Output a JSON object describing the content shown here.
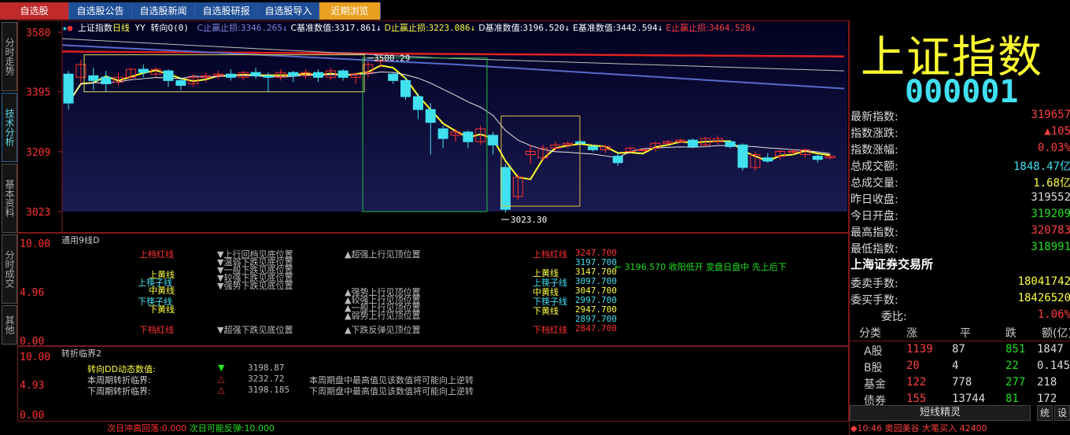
{
  "tabs": [
    "自选股",
    "自选股公告",
    "自选股新闻",
    "自选股研报",
    "自选股导入",
    "近期浏览"
  ],
  "side_tabs": [
    "分时走势",
    "技术分析",
    "基本资料",
    "分时成交",
    "其他"
  ],
  "chart_header": {
    "star": "★",
    "name": "上证指数",
    "period": "日线",
    "indicator": "YY 转向Q(0)",
    "items": [
      {
        "label": "C止赢止损:",
        "value": "3346.265↓",
        "color": "#7a8ae0"
      },
      {
        "label": "C基准数值:",
        "value": "3317.861↓",
        "color": "#ffffff"
      },
      {
        "label": "D止赢止损:",
        "value": "3223.086↓",
        "color": "#ffff40"
      },
      {
        "label": "D基准数值:",
        "value": "3196.520↓",
        "color": "#ffffff"
      },
      {
        "label": "E基准数值:",
        "value": "3442.594↓",
        "color": "#ffffff"
      },
      {
        "label": "E止赢止损:",
        "value": "3464.528↓",
        "color": "#ff4040"
      }
    ]
  },
  "price_axis": [
    "3580",
    "3395",
    "3209",
    "3023"
  ],
  "price_marks": {
    "high": "3500.29",
    "low": "3023.30"
  },
  "candles": [
    [
      3450,
      3360,
      3340,
      3460
    ],
    [
      3440,
      3480,
      3420,
      3495
    ],
    [
      3445,
      3430,
      3400,
      3470
    ],
    [
      3440,
      3420,
      3395,
      3460
    ],
    [
      3425,
      3440,
      3415,
      3455
    ],
    [
      3440,
      3465,
      3430,
      3470
    ],
    [
      3465,
      3455,
      3440,
      3480
    ],
    [
      3450,
      3465,
      3440,
      3470
    ],
    [
      3460,
      3430,
      3410,
      3465
    ],
    [
      3430,
      3415,
      3400,
      3440
    ],
    [
      3420,
      3440,
      3410,
      3450
    ],
    [
      3440,
      3445,
      3425,
      3455
    ],
    [
      3445,
      3450,
      3435,
      3460
    ],
    [
      3450,
      3440,
      3430,
      3465
    ],
    [
      3440,
      3455,
      3430,
      3460
    ],
    [
      3455,
      3445,
      3435,
      3470
    ],
    [
      3445,
      3440,
      3395,
      3455
    ],
    [
      3440,
      3455,
      3430,
      3465
    ],
    [
      3455,
      3445,
      3425,
      3460
    ],
    [
      3445,
      3455,
      3435,
      3465
    ],
    [
      3455,
      3440,
      3425,
      3465
    ],
    [
      3440,
      3460,
      3430,
      3470
    ],
    [
      3460,
      3440,
      3430,
      3465
    ],
    [
      3440,
      3450,
      3420,
      3455
    ],
    [
      3455,
      3480,
      3440,
      3490
    ],
    [
      3490,
      3500,
      3470,
      3500
    ],
    [
      3450,
      3430,
      3420,
      3455
    ],
    [
      3430,
      3380,
      3370,
      3440
    ],
    [
      3380,
      3340,
      3310,
      3390
    ],
    [
      3340,
      3300,
      3200,
      3360
    ],
    [
      3280,
      3250,
      3220,
      3290
    ],
    [
      3260,
      3270,
      3240,
      3280
    ],
    [
      3270,
      3240,
      3220,
      3275
    ],
    [
      3240,
      3280,
      3230,
      3290
    ],
    [
      3260,
      3230,
      3200,
      3270
    ],
    [
      3160,
      3030,
      3020,
      3170
    ],
    [
      3070,
      3130,
      3060,
      3140
    ],
    [
      3200,
      3210,
      3170,
      3230
    ],
    [
      3190,
      3220,
      3180,
      3230
    ],
    [
      3220,
      3230,
      3210,
      3240
    ],
    [
      3230,
      3235,
      3220,
      3240
    ],
    [
      3240,
      3235,
      3228,
      3245
    ],
    [
      3225,
      3215,
      3210,
      3230
    ],
    [
      3215,
      3225,
      3205,
      3230
    ],
    [
      3195,
      3175,
      3165,
      3205
    ],
    [
      3210,
      3220,
      3205,
      3225
    ],
    [
      3215,
      3215,
      3210,
      3220
    ],
    [
      3220,
      3235,
      3210,
      3240
    ],
    [
      3235,
      3240,
      3230,
      3245
    ],
    [
      3240,
      3245,
      3235,
      3250
    ],
    [
      3245,
      3225,
      3220,
      3250
    ],
    [
      3230,
      3250,
      3225,
      3255
    ],
    [
      3240,
      3250,
      3230,
      3260
    ],
    [
      3240,
      3225,
      3220,
      3245
    ],
    [
      3230,
      3160,
      3150,
      3235
    ],
    [
      3160,
      3200,
      3150,
      3210
    ],
    [
      3190,
      3180,
      3175,
      3205
    ],
    [
      3195,
      3210,
      3185,
      3215
    ],
    [
      3210,
      3210,
      3200,
      3218
    ],
    [
      3200,
      3215,
      3190,
      3220
    ],
    [
      3195,
      3185,
      3175,
      3200
    ],
    [
      3190,
      3195,
      3185,
      3200
    ]
  ],
  "pane2": {
    "title": "通用9线D",
    "axis": [
      "10.00",
      "4.96",
      "0.00"
    ],
    "left_labels": [
      {
        "t": "上档红线",
        "c": "#ff3030"
      },
      {
        "t": "上黄线",
        "c": "#ffff40"
      },
      {
        "t": "上筷子线",
        "c": "#40e0f0"
      },
      {
        "t": "中黄线",
        "c": "#ffff40"
      },
      {
        "t": "下筷子线",
        "c": "#40e0f0"
      },
      {
        "t": "下黄线",
        "c": "#ffff40"
      },
      {
        "t": "下档红线",
        "c": "#ff3030"
      }
    ],
    "down_labels": [
      "▼上行回档见底位置",
      "▼温弱下跌见底位置",
      "▼一般下跌见底位置",
      "▼较强下跌见底位置",
      "▼强势下跌见底位置",
      "▼超强下跌见底位置"
    ],
    "up_labels": [
      "▲超强上行见顶位置",
      "▲强势上行见顶位置",
      "▲较强上行见顶位置",
      "▲一般上行见顶位置",
      "▲弱势上行见顶位置",
      "▲下跌反弹见顶位置"
    ],
    "right_labels": [
      {
        "t": "上档红线",
        "v": "3247.700",
        "c": "#ff3030"
      },
      {
        "t": "",
        "v": "3197.700",
        "c": "#40e0f0"
      },
      {
        "t": "上黄线",
        "v": "3147.700",
        "c": "#ffff40"
      },
      {
        "t": "上筷子线",
        "v": "3097.700",
        "c": "#40e0f0"
      },
      {
        "t": "中黄线",
        "v": "3047.700",
        "c": "#ffff40"
      },
      {
        "t": "下筷子线",
        "v": "2997.700",
        "c": "#40e0f0"
      },
      {
        "t": "下黄线",
        "v": "2947.700",
        "c": "#ffff40"
      },
      {
        "t": "",
        "v": "2897.700",
        "c": "#40e0f0"
      },
      {
        "t": "下档红线",
        "v": "2847.700",
        "c": "#ff3030"
      }
    ],
    "note": "← 3196.570 收阳低开 变盘日盘中 先上后下"
  },
  "pane3": {
    "title": "转折临界2",
    "axis": [
      "10.00",
      "4.93",
      "0.00"
    ],
    "rows": [
      {
        "label": "转向DD动态数值:",
        "sym": "▼",
        "val": "3198.87",
        "desc": "",
        "lc": "#ffff40",
        "sc": "#20e020"
      },
      {
        "label": "本周期转折临界:",
        "sym": "△",
        "val": "3232.72",
        "desc": "本周期盘中最高值见该数值将可能向上逆转",
        "lc": "#cccccc",
        "sc": "#ff3030"
      },
      {
        "label": "下周期转折临界:",
        "sym": "△",
        "val": "3198.185",
        "desc": "下周期盘中最高值见该数值将可能向上逆转",
        "lc": "#cccccc",
        "sc": "#ff3030"
      }
    ]
  },
  "bottom": {
    "a_label": "次日冲高回落:",
    "a_val": "0.000",
    "b_label": "次日可能反弹:",
    "b_val": "10.000"
  },
  "quote": {
    "name": "上证指数",
    "code": "000001",
    "rows": [
      {
        "label": "最新指数:",
        "value": "319657",
        "color": "#ff4040"
      },
      {
        "label": "指数涨跌:",
        "value": "▲105",
        "color": "#ff4040"
      },
      {
        "label": "指数涨幅:",
        "value": "0.03%",
        "color": "#ff4040"
      },
      {
        "label": "总成交额:",
        "value": "1848.47亿",
        "color": "#40e0f0"
      },
      {
        "label": "总成交量:",
        "value": "1.68亿",
        "color": "#ffff40"
      },
      {
        "label": "昨日收盘:",
        "value": "319552",
        "color": "#dddddd"
      },
      {
        "label": "今日开盘:",
        "value": "319209",
        "color": "#20e020"
      },
      {
        "label": "最高指数:",
        "value": "320783",
        "color": "#ff4040"
      },
      {
        "label": "最低指数:",
        "value": "318991",
        "color": "#20e020"
      }
    ],
    "exchange": "上海证券交易所",
    "rows2": [
      {
        "label": "委卖手数:",
        "value": "18041742",
        "color": "#ffff40"
      },
      {
        "label": "委买手数:",
        "value": "18426520",
        "color": "#ffff40"
      },
      {
        "label": "委比:",
        "value": "1.06%",
        "color": "#ff4040"
      }
    ],
    "table_headers": [
      "分类",
      "涨",
      "平",
      "跌",
      "额(亿)"
    ],
    "table_rows": [
      {
        "c": "A股",
        "up": "1139",
        "flat": "87",
        "down": "851",
        "amt": "1847"
      },
      {
        "c": "B股",
        "up": "20",
        "flat": "4",
        "down": "22",
        "amt": "0.145"
      },
      {
        "c": "基金",
        "up": "122",
        "flat": "778",
        "down": "277",
        "amt": "218"
      },
      {
        "c": "债券",
        "up": "155",
        "flat": "13744",
        "down": "81",
        "amt": "172"
      }
    ],
    "wizard": "短线精灵",
    "btn1": "统",
    "btn2": "设",
    "ticker": "◆10:46 奥园美谷 大笔买入 42400"
  }
}
